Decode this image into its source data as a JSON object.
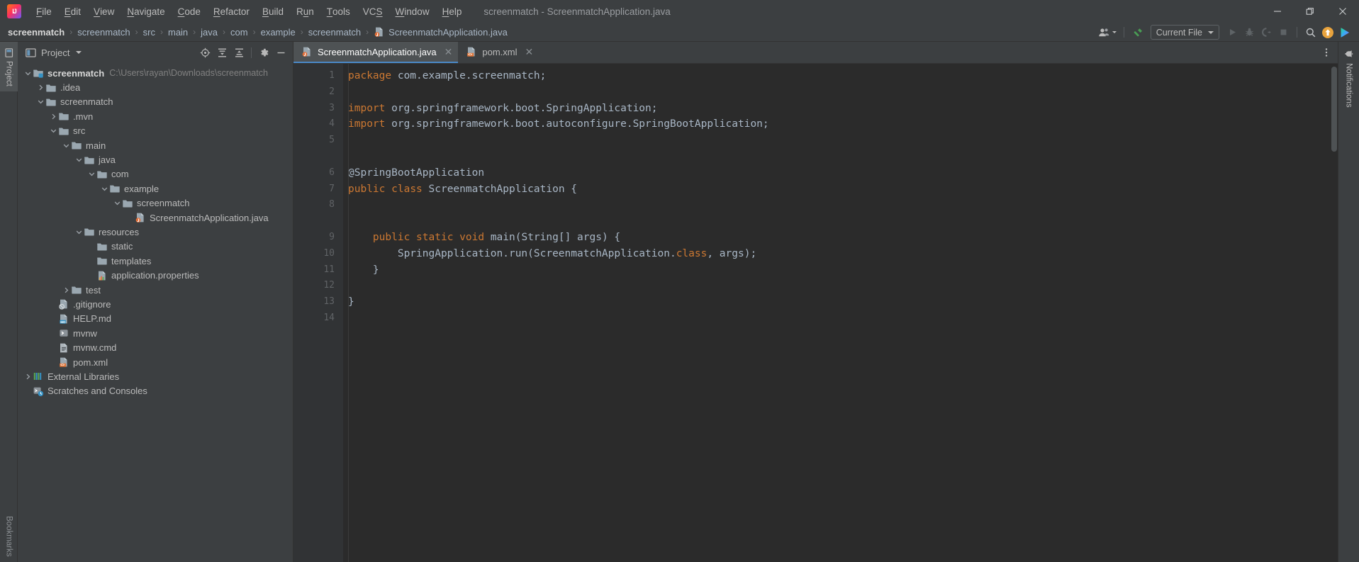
{
  "window": {
    "title": "screenmatch - ScreenmatchApplication.java",
    "logo_text": "IJ",
    "minimize_label": "Minimize",
    "maximize_label": "Restore",
    "close_label": "Close"
  },
  "menu": {
    "items": [
      {
        "label": "File",
        "mnemonic": "F"
      },
      {
        "label": "Edit",
        "mnemonic": "E"
      },
      {
        "label": "View",
        "mnemonic": "V"
      },
      {
        "label": "Navigate",
        "mnemonic": "N"
      },
      {
        "label": "Code",
        "mnemonic": "C"
      },
      {
        "label": "Refactor",
        "mnemonic": "R"
      },
      {
        "label": "Build",
        "mnemonic": "B"
      },
      {
        "label": "Run",
        "mnemonic": "u"
      },
      {
        "label": "Tools",
        "mnemonic": "T"
      },
      {
        "label": "VCS",
        "mnemonic": "S"
      },
      {
        "label": "Window",
        "mnemonic": "W"
      },
      {
        "label": "Help",
        "mnemonic": "H"
      }
    ]
  },
  "breadcrumb": {
    "separator": "›",
    "items": [
      {
        "label": "screenmatch",
        "type": "module",
        "bold": true
      },
      {
        "label": "screenmatch",
        "type": "dir"
      },
      {
        "label": "src",
        "type": "dir"
      },
      {
        "label": "main",
        "type": "dir"
      },
      {
        "label": "java",
        "type": "dir"
      },
      {
        "label": "com",
        "type": "package"
      },
      {
        "label": "example",
        "type": "package"
      },
      {
        "label": "screenmatch",
        "type": "package"
      },
      {
        "label": "ScreenmatchApplication.java",
        "type": "java-file",
        "icon": "java-class-icon"
      }
    ]
  },
  "nav_toolbar": {
    "account_label": "Account",
    "build_label": "Build Project",
    "run_config": {
      "label": "Current File",
      "dropdown_icon": "chevron-down-icon"
    },
    "run_label": "Run",
    "debug_label": "Debug",
    "coverage_label": "Run with Coverage",
    "stop_label": "Stop",
    "search_label": "Search Everywhere",
    "update_label": "Update Project",
    "ai_label": "AI Assistant",
    "accent_orange": "#e8a33d",
    "accent_green": "#499c54",
    "accent_blue": "#4a88c7"
  },
  "left_strip": {
    "top_tab": "Project",
    "bottom_tab": "Bookmarks"
  },
  "right_strip": {
    "tab": "Notifications",
    "icon": "bell-icon"
  },
  "tool_window": {
    "title": "Project",
    "dropdown_icon": "chevron-down-icon",
    "actions": [
      {
        "name": "select-opened-file-icon",
        "label": "Select Opened File"
      },
      {
        "name": "expand-all-icon",
        "label": "Expand All"
      },
      {
        "name": "collapse-all-icon",
        "label": "Collapse All"
      },
      {
        "name": "settings-gear-icon",
        "label": "Options"
      },
      {
        "name": "hide-icon",
        "label": "Hide"
      }
    ]
  },
  "project_tree": [
    {
      "label": "screenmatch",
      "path": "C:\\Users\\rayan\\Downloads\\screenmatch",
      "depth": 0,
      "arrow": "down",
      "icon": "module-folder-icon",
      "bold": true
    },
    {
      "label": ".idea",
      "depth": 1,
      "arrow": "right",
      "icon": "folder-icon"
    },
    {
      "label": "screenmatch",
      "depth": 1,
      "arrow": "down",
      "icon": "folder-icon"
    },
    {
      "label": ".mvn",
      "depth": 2,
      "arrow": "right",
      "icon": "folder-icon"
    },
    {
      "label": "src",
      "depth": 2,
      "arrow": "down",
      "icon": "folder-icon"
    },
    {
      "label": "main",
      "depth": 3,
      "arrow": "down",
      "icon": "folder-icon"
    },
    {
      "label": "java",
      "depth": 4,
      "arrow": "down",
      "icon": "source-folder-icon"
    },
    {
      "label": "com",
      "depth": 5,
      "arrow": "down",
      "icon": "package-folder-icon"
    },
    {
      "label": "example",
      "depth": 6,
      "arrow": "down",
      "icon": "package-folder-icon"
    },
    {
      "label": "screenmatch",
      "depth": 7,
      "arrow": "down",
      "icon": "package-folder-icon"
    },
    {
      "label": "ScreenmatchApplication.java",
      "depth": 8,
      "arrow": "none",
      "icon": "java-class-icon"
    },
    {
      "label": "resources",
      "depth": 4,
      "arrow": "down",
      "icon": "resource-folder-icon"
    },
    {
      "label": "static",
      "depth": 5,
      "arrow": "none",
      "icon": "folder-icon"
    },
    {
      "label": "templates",
      "depth": 5,
      "arrow": "none",
      "icon": "folder-icon"
    },
    {
      "label": "application.properties",
      "depth": 5,
      "arrow": "none",
      "icon": "properties-file-icon"
    },
    {
      "label": "test",
      "depth": 3,
      "arrow": "right",
      "icon": "folder-icon"
    },
    {
      "label": ".gitignore",
      "depth": 2,
      "arrow": "none",
      "icon": "gitignore-file-icon"
    },
    {
      "label": "HELP.md",
      "depth": 2,
      "arrow": "none",
      "icon": "markdown-file-icon"
    },
    {
      "label": "mvnw",
      "depth": 2,
      "arrow": "none",
      "icon": "shell-script-icon"
    },
    {
      "label": "mvnw.cmd",
      "depth": 2,
      "arrow": "none",
      "icon": "cmd-script-icon"
    },
    {
      "label": "pom.xml",
      "depth": 2,
      "arrow": "none",
      "icon": "maven-xml-icon"
    },
    {
      "label": "External Libraries",
      "depth": 0,
      "arrow": "right",
      "icon": "libraries-icon"
    },
    {
      "label": "Scratches and Consoles",
      "depth": 0,
      "arrow": "none",
      "icon": "scratches-icon"
    }
  ],
  "editor_tabs": [
    {
      "label": "ScreenmatchApplication.java",
      "icon": "java-class-icon",
      "active": true,
      "close_icon": "close-icon"
    },
    {
      "label": "pom.xml",
      "icon": "maven-xml-icon",
      "active": false,
      "close_icon": "close-icon"
    }
  ],
  "editor": {
    "file": "ScreenmatchApplication.java",
    "language": "java",
    "colors": {
      "background": "#2b2b2b",
      "gutter_background": "#313335",
      "line_number": "#606366",
      "keyword": "#cc7832",
      "identifier": "#a9b7c6",
      "annotation": "#bbb529"
    },
    "lines": [
      {
        "n": 1,
        "fold": "none",
        "tokens": [
          {
            "t": "package",
            "c": "kw"
          },
          {
            "t": " com.example.screenmatch;",
            "c": "ident"
          }
        ]
      },
      {
        "n": 2,
        "fold": "none",
        "tokens": []
      },
      {
        "n": 3,
        "fold": "start",
        "tokens": [
          {
            "t": "import",
            "c": "kw"
          },
          {
            "t": " org.springframework.boot.SpringApplication;",
            "c": "ident"
          }
        ]
      },
      {
        "n": 4,
        "fold": "end",
        "tokens": [
          {
            "t": "import",
            "c": "kw"
          },
          {
            "t": " org.springframework.boot.autoconfigure.SpringBootApplication;",
            "c": "ident"
          }
        ]
      },
      {
        "n": 5,
        "fold": "none",
        "tokens": []
      },
      {
        "n": "",
        "fold": "none",
        "tokens": []
      },
      {
        "n": 6,
        "fold": "none",
        "tokens": [
          {
            "t": "@SpringBootApplication",
            "c": "ident"
          }
        ]
      },
      {
        "n": 7,
        "fold": "none",
        "tokens": [
          {
            "t": "public",
            "c": "kw"
          },
          {
            "t": " ",
            "c": "ident"
          },
          {
            "t": "class",
            "c": "kw"
          },
          {
            "t": " ScreenmatchApplication {",
            "c": "ident"
          }
        ]
      },
      {
        "n": 8,
        "fold": "none",
        "tokens": []
      },
      {
        "n": "",
        "fold": "none",
        "tokens": []
      },
      {
        "n": 9,
        "fold": "start",
        "tokens": [
          {
            "t": "    ",
            "c": "ident"
          },
          {
            "t": "public",
            "c": "kw"
          },
          {
            "t": " ",
            "c": "ident"
          },
          {
            "t": "static",
            "c": "kw"
          },
          {
            "t": " ",
            "c": "ident"
          },
          {
            "t": "void",
            "c": "kw"
          },
          {
            "t": " main(String[] args) {",
            "c": "ident"
          }
        ]
      },
      {
        "n": 10,
        "fold": "none",
        "tokens": [
          {
            "t": "        SpringApplication.run(ScreenmatchApplication.",
            "c": "ident"
          },
          {
            "t": "class",
            "c": "kw"
          },
          {
            "t": ", args);",
            "c": "ident"
          }
        ]
      },
      {
        "n": 11,
        "fold": "end",
        "tokens": [
          {
            "t": "    }",
            "c": "ident"
          }
        ]
      },
      {
        "n": 12,
        "fold": "none",
        "tokens": []
      },
      {
        "n": 13,
        "fold": "none",
        "tokens": [
          {
            "t": "}",
            "c": "ident"
          }
        ]
      },
      {
        "n": 14,
        "fold": "none",
        "tokens": []
      }
    ]
  }
}
